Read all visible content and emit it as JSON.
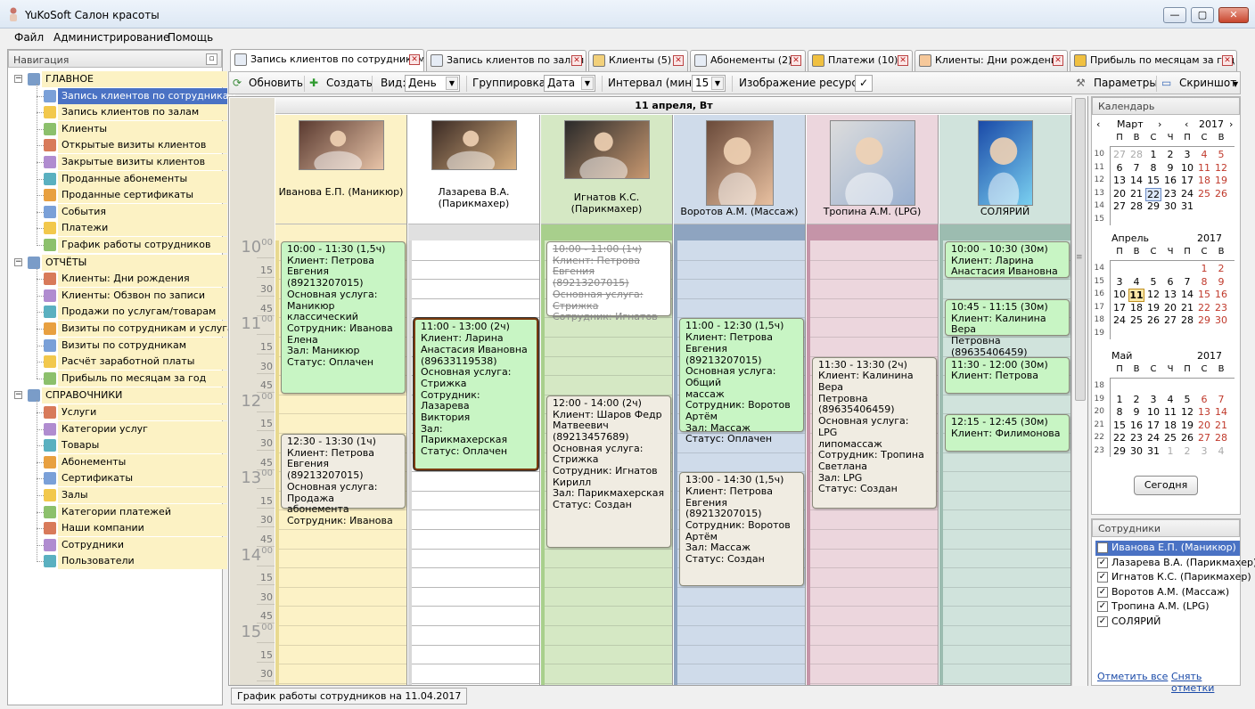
{
  "window": {
    "title": "YuKoSoft Салон красоты",
    "min": "—",
    "max": "▢",
    "close": "✕"
  },
  "menu": [
    "Файл",
    "Администрирование",
    "Помощь"
  ],
  "nav": {
    "title": "Навигация",
    "pin": "▫",
    "groups": [
      {
        "label": "ГЛАВНОЕ",
        "items": [
          "Запись клиентов по сотрудникам",
          "Запись клиентов по залам",
          "Клиенты",
          "Открытые визиты клиентов",
          "Закрытые визиты клиентов",
          "Проданные абонементы",
          "Проданные сертификаты",
          "События",
          "Платежи",
          "График работы сотрудников"
        ]
      },
      {
        "label": "ОТЧЁТЫ",
        "items": [
          "Клиенты: Дни рождения",
          "Клиенты: Обзвон по записи",
          "Продажи по услугам/товарам",
          "Визиты по сотрудникам и услугам",
          "Визиты по сотрудникам",
          "Расчёт заработной платы",
          "Прибыль по месяцам за год"
        ]
      },
      {
        "label": "СПРАВОЧНИКИ",
        "items": [
          "Услуги",
          "Категории услуг",
          "Товары",
          "Абонементы",
          "Сертификаты",
          "Залы",
          "Категории платежей",
          "Наши компании",
          "Сотрудники",
          "Пользователи"
        ]
      }
    ]
  },
  "tabs": [
    "Запись клиентов по сотрудникам",
    "Запись клиентов по залам",
    "Клиенты (5)",
    "Абонементы (2)",
    "Платежи (10)",
    "Клиенты: Дни рождения",
    "Прибыль по месяцам за год"
  ],
  "toolbar": {
    "refresh": "Обновить",
    "create": "Создать",
    "view_label": "Вид:",
    "view_value": "День",
    "group_label": "Группировка:",
    "group_value": "Дата",
    "interval_label": "Интервал (мин):",
    "interval_value": "15",
    "resimg_label": "Изображение ресурса",
    "resimg_check": "✓",
    "params": "Параметры",
    "screenshot": "Скриншот"
  },
  "schedule": {
    "date": "11 апреля, Вт",
    "times": [
      {
        "h": "10",
        "m": "00"
      },
      {
        "m": "15"
      },
      {
        "m": "30"
      },
      {
        "m": "45"
      },
      {
        "h": "11",
        "m": "00"
      },
      {
        "m": "15"
      },
      {
        "m": "30"
      },
      {
        "m": "45"
      },
      {
        "h": "12",
        "m": "00"
      },
      {
        "m": "15"
      },
      {
        "m": "30"
      },
      {
        "m": "45"
      },
      {
        "h": "13",
        "m": "00"
      },
      {
        "m": "15"
      },
      {
        "m": "30"
      },
      {
        "m": "45"
      },
      {
        "h": "14",
        "m": "00"
      },
      {
        "m": "15"
      },
      {
        "m": "30"
      },
      {
        "m": "45"
      },
      {
        "h": "15",
        "m": "00"
      },
      {
        "m": "15"
      },
      {
        "m": "30"
      }
    ],
    "resources": [
      {
        "name": "Иванова Е.П. (Маникюр)",
        "color": "#fcf2c6",
        "band": "#fcf2c6",
        "bar": "#e8d990"
      },
      {
        "name": "Лазарева В.А. (Парикмахер)",
        "color": "#ffffff",
        "band": "#e0e0e0",
        "bar": "#d8d8d8"
      },
      {
        "name": "Игнатов К.С. (Парикмахер)",
        "color": "#d5e8c4",
        "band": "#a8cf8c",
        "bar": "#a8cf8c"
      },
      {
        "name": "Воротов А.М. (Массаж)",
        "color": "#cfdbea",
        "band": "#8ea4c0",
        "bar": "#8ea4c0"
      },
      {
        "name": "Тропина А.М. (LPG)",
        "color": "#ecd6dd",
        "band": "#c594a8",
        "bar": "#c594a8"
      },
      {
        "name": "СОЛЯРИЙ",
        "color": "#d0e3dc",
        "band": "#9cbcb0",
        "bar": "#9cbcb0"
      }
    ],
    "appointments": [
      {
        "col": 0,
        "start": 0,
        "len": 8,
        "status": "paid",
        "lines": [
          "10:00 - 11:30 (1,5ч)",
          "Клиент: Петрова",
          "Евгения (89213207015)",
          "Основная услуга:",
          "Маникюр классический",
          "Сотрудник: Иванова",
          "Елена",
          "Зал: Маникюр",
          "Статус: Оплачен"
        ]
      },
      {
        "col": 0,
        "start": 10,
        "len": 4,
        "status": "new",
        "lines": [
          "12:30 - 13:30 (1ч)",
          "Клиент: Петрова",
          "Евгения (89213207015)",
          "Основная услуга:",
          "Продажа абонемента",
          "Сотрудник: Иванова"
        ]
      },
      {
        "col": 1,
        "start": 4,
        "len": 8,
        "status": "paid sel",
        "lines": [
          "11:00 - 13:00 (2ч)",
          "Клиент: Ларина",
          "Анастасия Ивановна",
          "(89633119538)",
          "Основная услуга:",
          "Стрижка",
          "Сотрудник: Лазарева",
          "Виктория",
          "Зал: Парикмахерская",
          "Статус: Оплачен"
        ]
      },
      {
        "col": 2,
        "start": 0,
        "len": 4,
        "status": "cancel",
        "lines": [
          "10:00 - 11:00 (1ч)",
          "Клиент: Петрова",
          "Евгения (89213207015)",
          "Основная услуга:",
          "Стрижка",
          "Сотрудник: Игнатов"
        ]
      },
      {
        "col": 2,
        "start": 8,
        "len": 8,
        "status": "new",
        "lines": [
          "12:00 - 14:00 (2ч)",
          "Клиент: Шаров Федр",
          "Матвеевич",
          "(89213457689)",
          "Основная услуга:",
          "Стрижка",
          "Сотрудник: Игнатов",
          "Кирилл",
          "Зал: Парикмахерская",
          "Статус: Создан"
        ]
      },
      {
        "col": 3,
        "start": 4,
        "len": 6,
        "status": "paid",
        "lines": [
          "11:00 - 12:30 (1,5ч)",
          "Клиент: Петрова",
          "Евгения (89213207015)",
          "Основная услуга: Общий",
          "массаж",
          "Сотрудник: Воротов",
          "Артём",
          "Зал: Массаж",
          "Статус: Оплачен"
        ]
      },
      {
        "col": 3,
        "start": 12,
        "len": 6,
        "status": "new",
        "lines": [
          "13:00 - 14:30 (1,5ч)",
          "Клиент: Петрова",
          "Евгения (89213207015)",
          "Сотрудник: Воротов",
          "Артём",
          "Зал: Массаж",
          "Статус: Создан"
        ]
      },
      {
        "col": 4,
        "start": 6,
        "len": 8,
        "status": "new",
        "lines": [
          "11:30 - 13:30 (2ч)",
          "Клиент: Калинина Вера",
          "Петровна (89635406459)",
          "Основная услуга: LPG",
          "липомассаж",
          "Сотрудник: Тропина",
          "Светлана",
          "Зал: LPG",
          "Статус: Создан"
        ]
      },
      {
        "col": 5,
        "start": 0,
        "len": 2,
        "status": "paid",
        "lines": [
          "10:00 - 10:30 (30м)",
          "Клиент: Ларина",
          "Анастасия Ивановна"
        ]
      },
      {
        "col": 5,
        "start": 3,
        "len": 2,
        "status": "paid",
        "lines": [
          "10:45 - 11:15 (30м)",
          "Клиент: Калинина Вера",
          "Петровна (89635406459)"
        ]
      },
      {
        "col": 5,
        "start": 6,
        "len": 2,
        "status": "paid",
        "lines": [
          "11:30 - 12:00 (30м)",
          "Клиент: Петрова"
        ]
      },
      {
        "col": 5,
        "start": 9,
        "len": 2,
        "status": "paid",
        "lines": [
          "12:15 - 12:45 (30м)",
          "Клиент: Филимонова"
        ]
      }
    ]
  },
  "status_tab": "График работы сотрудников на 11.04.2017",
  "calendar": {
    "title": "Календарь",
    "dow": [
      "П",
      "В",
      "С",
      "Ч",
      "П",
      "С",
      "В"
    ],
    "today_btn": "Сегодня",
    "months": [
      {
        "name": "Март",
        "year": "2017",
        "nav_left": "‹",
        "nav_right": "›",
        "year_left": "‹",
        "year_right": "›",
        "weeks": [
          [
            "10",
            "27",
            "28",
            "1",
            "2",
            "3",
            "4",
            "5"
          ],
          [
            "11",
            "6",
            "7",
            "8",
            "9",
            "10",
            "11",
            "12"
          ],
          [
            "12",
            "13",
            "14",
            "15",
            "16",
            "17",
            "18",
            "19"
          ],
          [
            "13",
            "20",
            "21",
            "22",
            "23",
            "24",
            "25",
            "26"
          ],
          [
            "14",
            "27",
            "28",
            "29",
            "30",
            "31",
            "",
            ""
          ],
          [
            "15",
            "",
            "",
            "",
            "",
            "",
            "",
            ""
          ]
        ]
      },
      {
        "name": "Апрель",
        "year": "2017",
        "weeks": [
          [
            "14",
            "",
            "",
            "",
            "",
            "",
            "1",
            "2"
          ],
          [
            "15",
            "3",
            "4",
            "5",
            "6",
            "7",
            "8",
            "9"
          ],
          [
            "16",
            "10",
            "11",
            "12",
            "13",
            "14",
            "15",
            "16"
          ],
          [
            "17",
            "17",
            "18",
            "19",
            "20",
            "21",
            "22",
            "23"
          ],
          [
            "18",
            "24",
            "25",
            "26",
            "27",
            "28",
            "29",
            "30"
          ],
          [
            "19",
            "",
            "",
            "",
            "",
            "",
            "",
            ""
          ]
        ]
      },
      {
        "name": "Май",
        "year": "2017",
        "weeks": [
          [
            "18",
            "",
            "",
            "",
            "",
            "",
            "",
            ""
          ],
          [
            "19",
            "1",
            "2",
            "3",
            "4",
            "5",
            "6",
            "7"
          ],
          [
            "20",
            "8",
            "9",
            "10",
            "11",
            "12",
            "13",
            "14"
          ],
          [
            "21",
            "15",
            "16",
            "17",
            "18",
            "19",
            "20",
            "21"
          ],
          [
            "22",
            "22",
            "23",
            "24",
            "25",
            "26",
            "27",
            "28"
          ],
          [
            "23",
            "29",
            "30",
            "31",
            "1",
            "2",
            "3",
            "4"
          ]
        ]
      }
    ]
  },
  "employees": {
    "title": "Сотрудники",
    "items": [
      "Иванова Е.П. (Маникюр)",
      "Лазарева В.А. (Парикмахер)",
      "Игнатов К.С. (Парикмахер)",
      "Воротов А.М. (Массаж)",
      "Тропина А.М. (LPG)",
      "СОЛЯРИЙ"
    ],
    "check": "✓",
    "select_all": "Отметить все",
    "clear": "Снять отметки"
  },
  "colors": {
    "accent": "#4a72c4",
    "paid": "#c8f5c4",
    "new": "#f0ece2"
  }
}
